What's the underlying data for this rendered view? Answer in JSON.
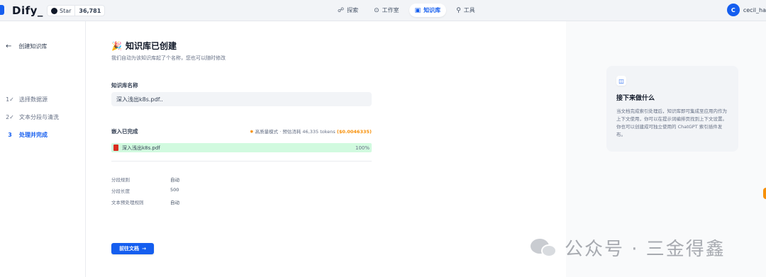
{
  "app": {
    "name": "Dify_"
  },
  "github": {
    "star_label": "Star",
    "count": "36,781"
  },
  "nav": [
    {
      "icon": "☍",
      "label": "探索"
    },
    {
      "icon": "⊙",
      "label": "工作室"
    },
    {
      "icon": "▣",
      "label": "知识库"
    },
    {
      "icon": "⚲",
      "label": "工具"
    }
  ],
  "user": {
    "initial": "C",
    "name": "cecil_ha"
  },
  "sidebar": {
    "back_label": "创建知识库",
    "steps": [
      {
        "mark": "1✓",
        "label": "选择数据源"
      },
      {
        "mark": "2✓",
        "label": "文本分段与清洗"
      },
      {
        "mark": "3",
        "label": "处理并完成"
      }
    ]
  },
  "main": {
    "title": "知识库已创建",
    "subtitle": "我们自动为该知识库起了个名称，您也可以随时修改",
    "name_label": "知识库名称",
    "name_value": "深入浅出k8s.pdf..",
    "embed_title": "嵌入已完成",
    "embed_mode": "高质量模式 · 预估消耗 46,335 tokens",
    "embed_cost": "($0.0046335)",
    "file_name": "深入浅出k8s.pdf",
    "file_progress": "100%",
    "rules": [
      {
        "key": "分段规则",
        "value": "自动"
      },
      {
        "key": "分段长度",
        "value": "500"
      },
      {
        "key": "文本预处理规则",
        "value": "自动"
      }
    ],
    "go_button": "前往文档"
  },
  "next_card": {
    "title": "接下来做什么",
    "body": "当文档完成索引处理后，知识库即可集成至应用内作为上下文使用，你可以在提示词编排页找到上下文设置。你也可以创建成可独立使用的 ChatGPT 索引插件发布。"
  },
  "watermark": {
    "text": "公众号 · 三金得鑫"
  },
  "colors": {
    "accent": "#155eef",
    "success_bg": "#d1fadf",
    "warning": "#f79009"
  }
}
